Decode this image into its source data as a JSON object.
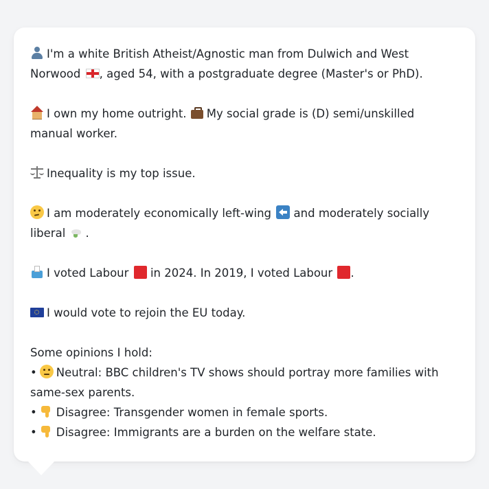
{
  "profile": {
    "identity_text_a": "I'm a white British Atheist/Agnostic man from Dulwich and West Norwood",
    "identity_text_b": ", aged 54, with a postgraduate degree (Master's or PhD).",
    "home_text": "I own my home outright.",
    "grade_text": "My social grade is (D) semi/unskilled manual worker.",
    "issue_text": "Inequality is my top issue.",
    "ideology_text_a": "I am moderately economically left-wing",
    "ideology_text_b": "and moderately socially liberal",
    "ideology_text_c": ".",
    "vote_text_a": "I voted Labour",
    "vote_text_b": "in 2024. In 2019, I voted Labour",
    "vote_text_c": ".",
    "eu_text": "I would vote to rejoin the EU today.",
    "opinions_heading": "Some opinions I hold:",
    "opinions": [
      {
        "bullet": "•",
        "icon": "neutral-face-icon",
        "text": "Neutral: BBC children's TV shows should portray more families with same-sex parents."
      },
      {
        "bullet": "•",
        "icon": "thumbs-down-icon",
        "text": "Disagree: Transgender women in female sports."
      },
      {
        "bullet": "•",
        "icon": "thumbs-down-icon",
        "text": "Disagree: Immigrants are a burden on the welfare state."
      }
    ]
  },
  "colors": {
    "background": "#f3f4f6",
    "bubble": "#ffffff",
    "text": "#1f2328",
    "labour_red": "#e0282d"
  }
}
